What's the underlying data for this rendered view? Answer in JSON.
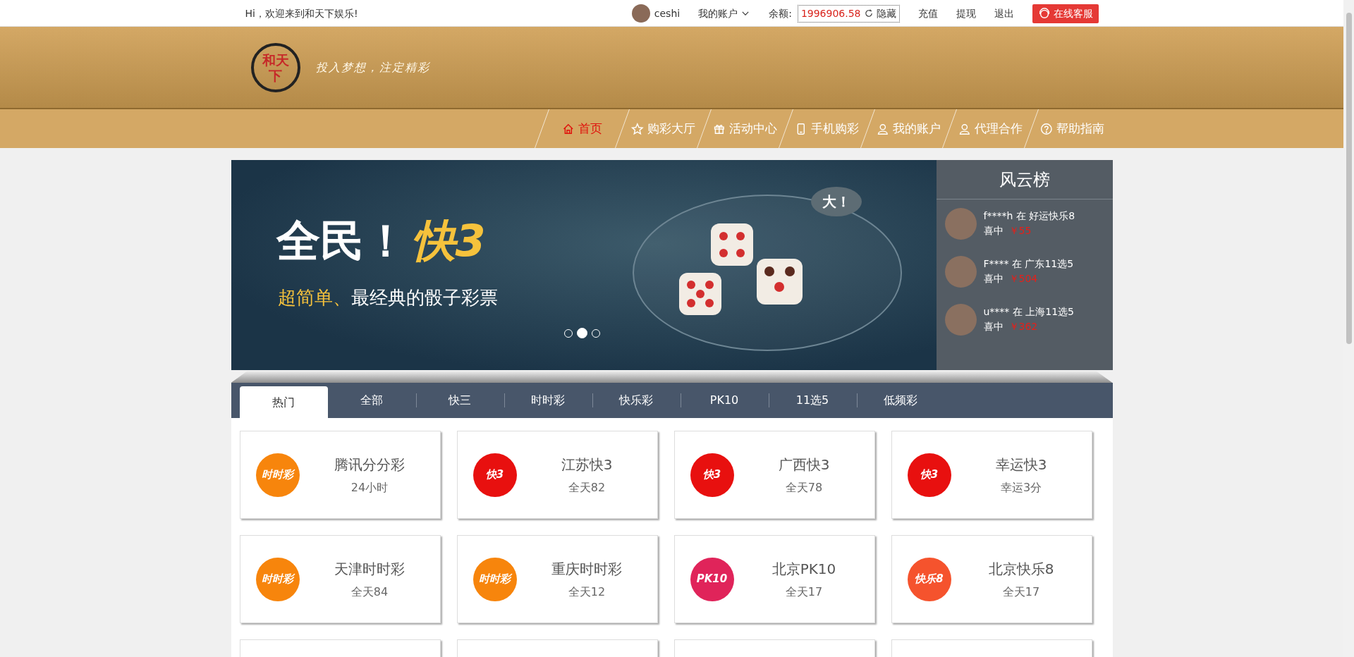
{
  "top_bar": {
    "greeting": "Hi，欢迎来到和天下娱乐!",
    "username": "ceshi",
    "account_menu": "我的账户",
    "balance_label": "余额:",
    "balance": "1996906.58",
    "hide": "隐藏",
    "links": [
      "充值",
      "提现",
      "退出"
    ],
    "service_button": "在线客服"
  },
  "header": {
    "logo_text": "和天下",
    "slogan": "投入梦想，注定精彩"
  },
  "nav": [
    {
      "label": "首页",
      "kind": "home",
      "selected": true
    },
    {
      "label": "购彩大厅",
      "kind": "lobby",
      "selected": false
    },
    {
      "label": "活动中心",
      "kind": "events",
      "selected": false
    },
    {
      "label": "手机购彩",
      "kind": "mobile",
      "selected": false
    },
    {
      "label": "我的账户",
      "kind": "account",
      "selected": false
    },
    {
      "label": "代理合作",
      "kind": "agent",
      "selected": false
    },
    {
      "label": "帮助指南",
      "kind": "help",
      "selected": false
    }
  ],
  "banner": {
    "title": "全民！",
    "title_accent": "快3",
    "subtitle_accent": "超简单、",
    "subtitle": "最经典的骰子彩票",
    "bubble": "大！",
    "dots": [
      {
        "selected": false
      },
      {
        "selected": true
      },
      {
        "selected": false
      }
    ]
  },
  "leaderboard": {
    "title": "风云榜",
    "entries": [
      {
        "user": "f****h",
        "verb": "在",
        "game": "好运快乐8",
        "won_label": "喜中",
        "amount": "￥55"
      },
      {
        "user": "F****",
        "verb": "在",
        "game": "广东11选5",
        "won_label": "喜中",
        "amount": "￥504"
      },
      {
        "user": "u****",
        "verb": "在",
        "game": "上海11选5",
        "won_label": "喜中",
        "amount": "￥362"
      }
    ]
  },
  "tabs": [
    {
      "label": "热门",
      "selected": true
    },
    {
      "label": "全部",
      "selected": false
    },
    {
      "label": "快三",
      "selected": false
    },
    {
      "label": "时时彩",
      "selected": false
    },
    {
      "label": "快乐彩",
      "selected": false
    },
    {
      "label": "PK10",
      "selected": false
    },
    {
      "label": "11选5",
      "selected": false
    },
    {
      "label": "低频彩",
      "selected": false
    }
  ],
  "lotteries": [
    {
      "kind": "ssc",
      "logo": "时时彩",
      "name": "腾讯分分彩",
      "schedule": "24小时"
    },
    {
      "kind": "k3",
      "logo": "快3",
      "name": "江苏快3",
      "schedule": "全天82"
    },
    {
      "kind": "k3",
      "logo": "快3",
      "name": "广西快3",
      "schedule": "全天78"
    },
    {
      "kind": "k3",
      "logo": "快3",
      "name": "幸运快3",
      "schedule": "幸运3分"
    },
    {
      "kind": "ssc",
      "logo": "时时彩",
      "name": "天津时时彩",
      "schedule": "全天84"
    },
    {
      "kind": "ssc",
      "logo": "时时彩",
      "name": "重庆时时彩",
      "schedule": "全天12"
    },
    {
      "kind": "pk10",
      "logo": "PK10",
      "name": "北京PK10",
      "schedule": "全天17"
    },
    {
      "kind": "kl8",
      "logo": "快乐8",
      "name": "北京快乐8",
      "schedule": "全天17"
    },
    {
      "kind": "partial"
    },
    {
      "kind": "partial"
    },
    {
      "kind": "partial"
    },
    {
      "kind": "partial"
    }
  ]
}
